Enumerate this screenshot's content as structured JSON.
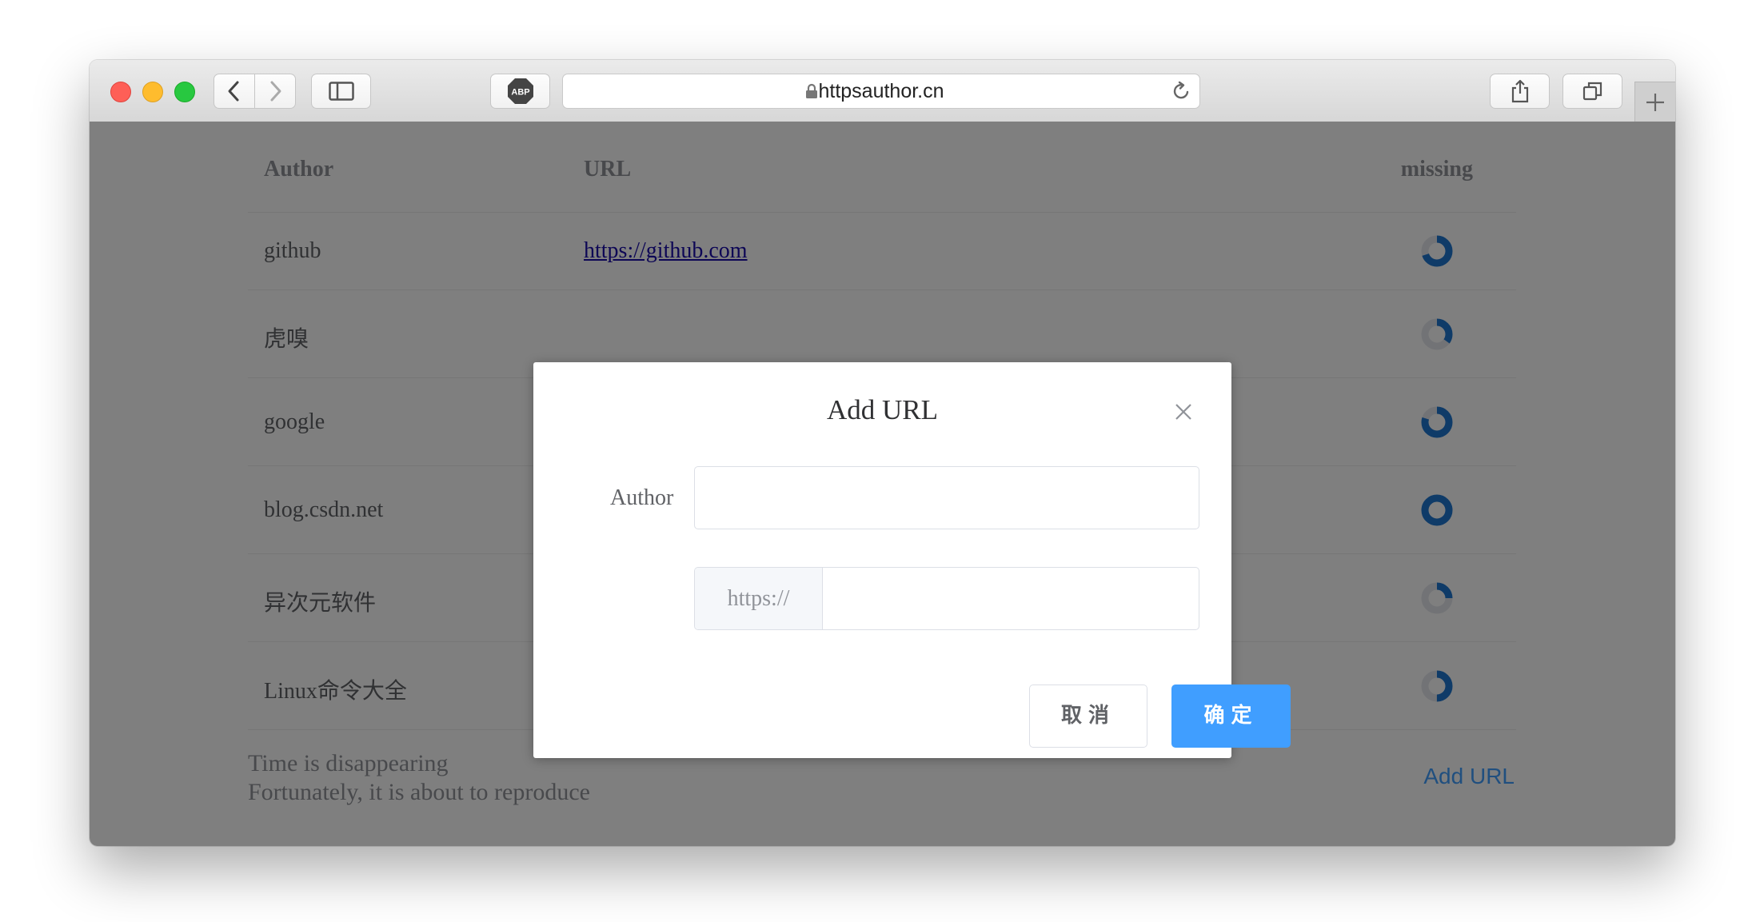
{
  "browser": {
    "url": "httpsauthor.cn",
    "abp_label": "ABP"
  },
  "table": {
    "headers": {
      "author": "Author",
      "url": "URL",
      "missing": "missing"
    },
    "rows": [
      {
        "author": "github",
        "url": "https://github.com",
        "missing_fraction": 0.7
      },
      {
        "author": "虎嗅",
        "url": "",
        "missing_fraction": 0.35
      },
      {
        "author": "google",
        "url": "",
        "missing_fraction": 0.8
      },
      {
        "author": "blog.csdn.net",
        "url": "",
        "missing_fraction": 1.0
      },
      {
        "author": "异次元软件",
        "url": "",
        "missing_fraction": 0.25
      },
      {
        "author": "Linux命令大全",
        "url": "",
        "missing_fraction": 0.5
      }
    ]
  },
  "footer": {
    "line1": "Time is disappearing",
    "line2": "Fortunately, it is about to reproduce",
    "add_url": "Add URL"
  },
  "dialog": {
    "title": "Add URL",
    "author_label": "Author",
    "author_value": "",
    "url_prefix": "https://",
    "url_value": "",
    "cancel": "取消",
    "confirm": "确定"
  },
  "colors": {
    "ring_fill": "#1f77d0",
    "ring_track": "#e4e7ed",
    "primary": "#409eff"
  }
}
